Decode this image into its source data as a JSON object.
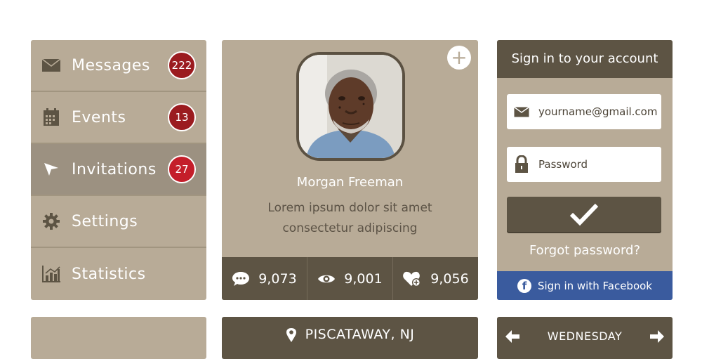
{
  "menu": {
    "items": [
      {
        "label": "Messages",
        "icon": "envelope-icon",
        "badge": "222",
        "badge_color": "#9b1b1f"
      },
      {
        "label": "Events",
        "icon": "calendar-icon",
        "badge": "13",
        "badge_color": "#9b1b1f"
      },
      {
        "label": "Invitations",
        "icon": "paper-plane-icon",
        "badge": "27",
        "badge_color": "#c41e2a",
        "active": true
      },
      {
        "label": "Settings",
        "icon": "gear-icon"
      },
      {
        "label": "Statistics",
        "icon": "bar-chart-icon"
      }
    ]
  },
  "profile": {
    "name": "Morgan Freeman",
    "bio_line1": "Lorem ipsum dolor sit amet",
    "bio_line2": "consectetur adipiscing",
    "add_label": "+",
    "stats": [
      {
        "icon": "comment-icon",
        "value": "9,073"
      },
      {
        "icon": "eye-icon",
        "value": "9,001"
      },
      {
        "icon": "heart-add-icon",
        "value": "9,056"
      }
    ]
  },
  "signin": {
    "title": "Sign in to your account",
    "email_value": "yourname@gmail.com",
    "password_placeholder": "Password",
    "forgot_label": "Forgot password?",
    "facebook_label": "Sign in with Facebook",
    "facebook_icon_letter": "f"
  },
  "location": {
    "label": "PISCATAWAY, NJ"
  },
  "day": {
    "label": "WEDNESDAY"
  },
  "colors": {
    "panel": "#b8ab97",
    "dark": "#5d5444",
    "active_item": "#9c9181",
    "facebook": "#3a5b9e"
  }
}
